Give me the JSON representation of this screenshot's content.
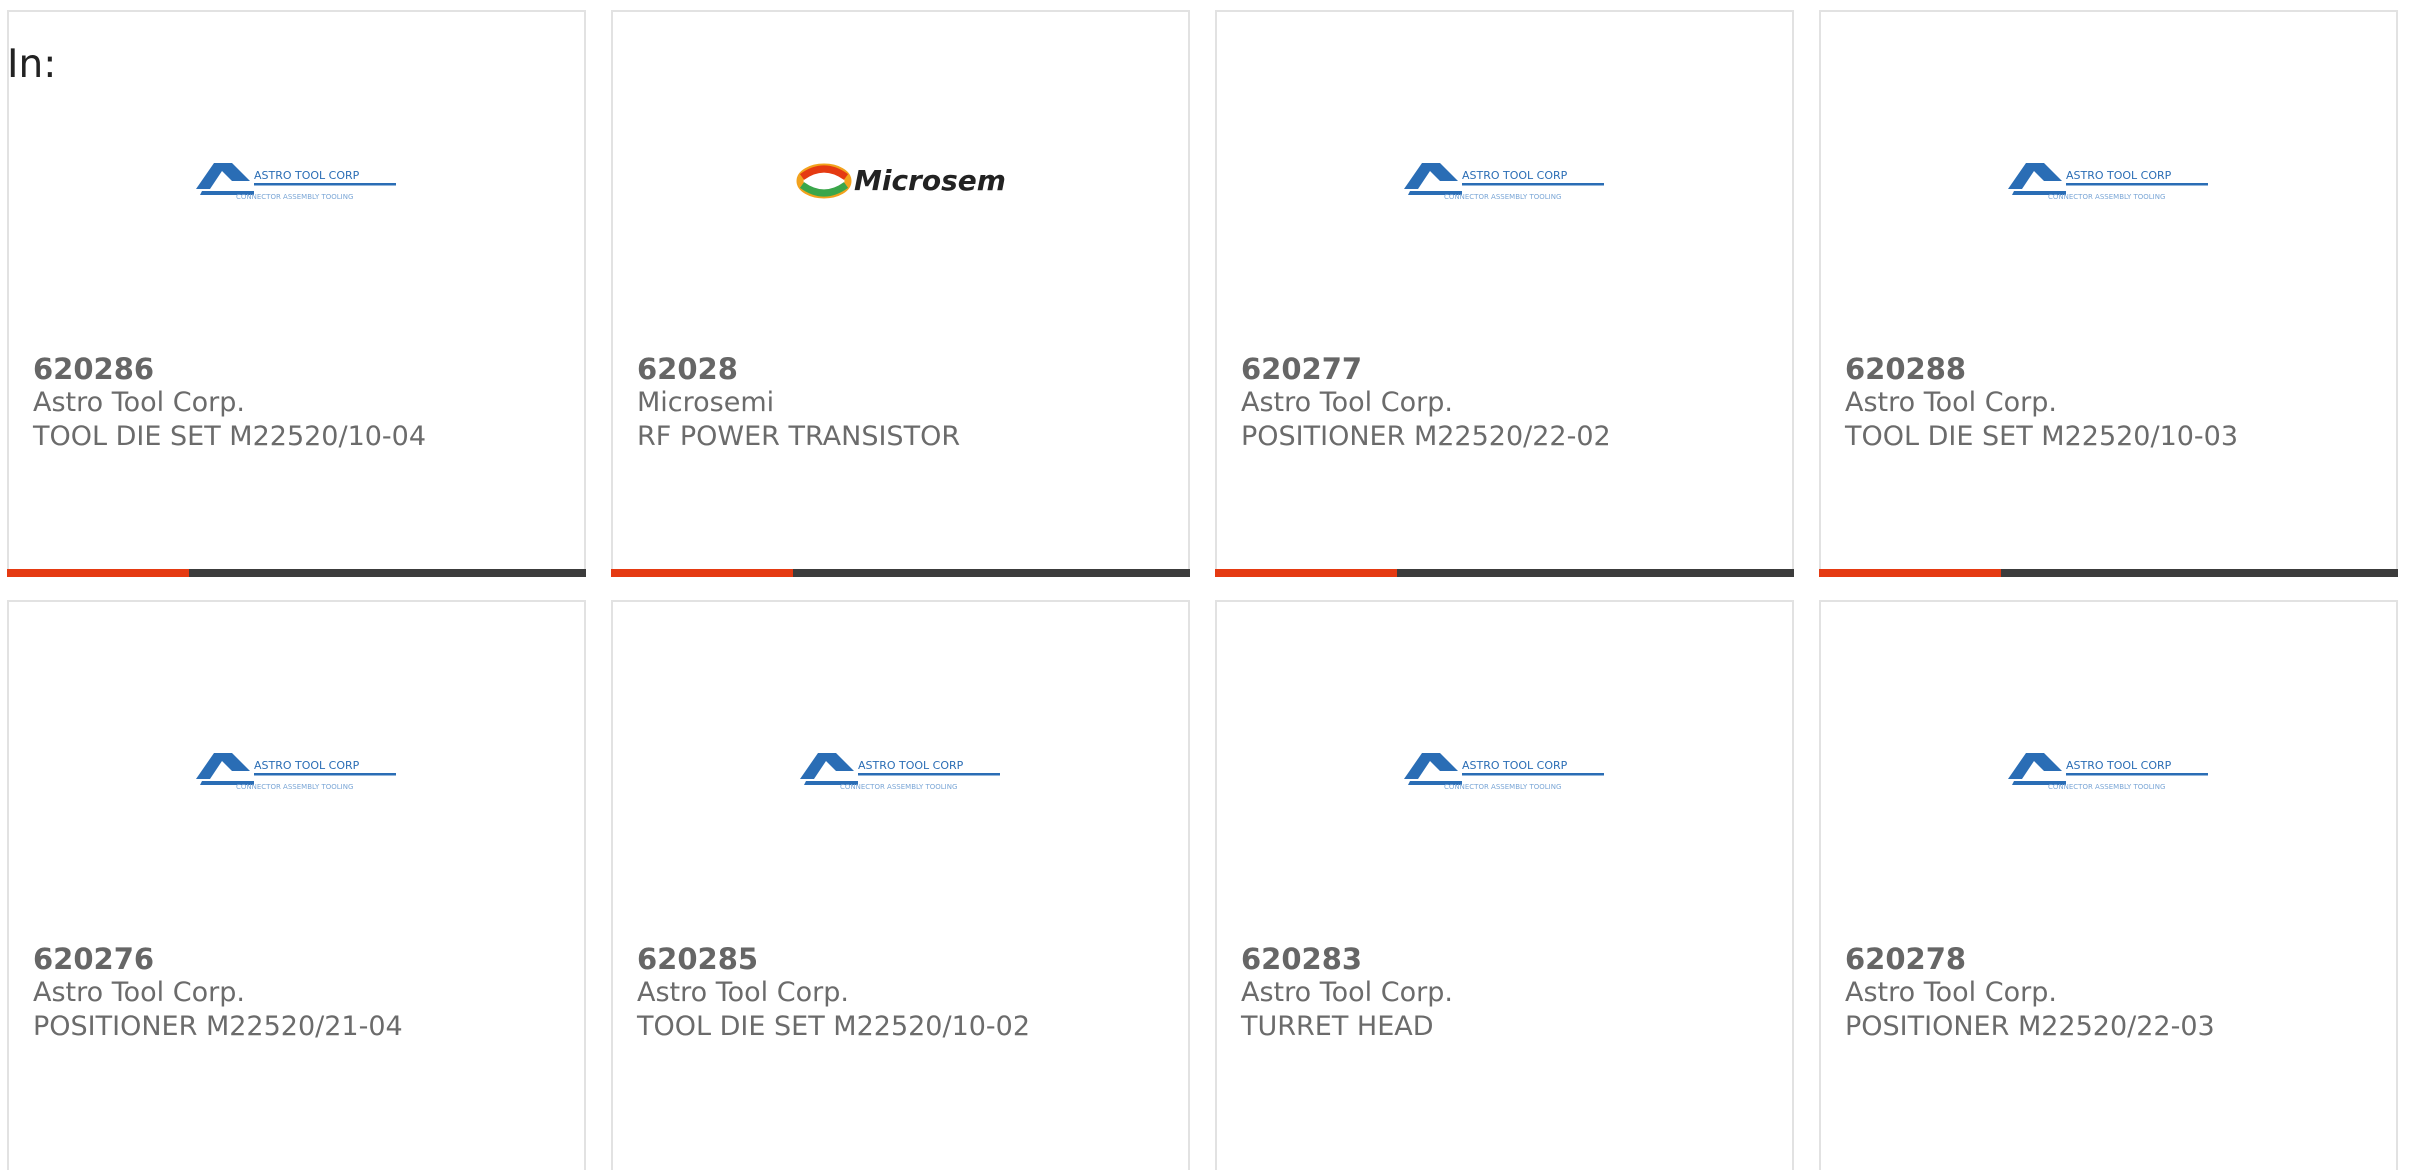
{
  "header": {
    "label": "In:"
  },
  "logos": {
    "astro": {
      "name": "ASTRO TOOL CORP",
      "tagline": "CONNECTOR ASSEMBLY TOOLING",
      "color": "#2a6db5"
    },
    "microsemi": {
      "name": "Microsemi",
      "color": "#222222"
    }
  },
  "accent_color": "#e53a12",
  "bar_color": "#3c3c3c",
  "progress_fraction": 0.315,
  "products": [
    {
      "part": "620286",
      "manufacturer": "Astro Tool Corp.",
      "description": "TOOL DIE SET M22520/10-04",
      "logo": "astro"
    },
    {
      "part": "62028",
      "manufacturer": "Microsemi",
      "description": "RF POWER TRANSISTOR",
      "logo": "microsemi"
    },
    {
      "part": "620277",
      "manufacturer": "Astro Tool Corp.",
      "description": "POSITIONER M22520/22-02",
      "logo": "astro"
    },
    {
      "part": "620288",
      "manufacturer": "Astro Tool Corp.",
      "description": "TOOL DIE SET M22520/10-03",
      "logo": "astro"
    },
    {
      "part": "620276",
      "manufacturer": "Astro Tool Corp.",
      "description": "POSITIONER M22520/21-04",
      "logo": "astro"
    },
    {
      "part": "620285",
      "manufacturer": "Astro Tool Corp.",
      "description": "TOOL DIE SET M22520/10-02",
      "logo": "astro"
    },
    {
      "part": "620283",
      "manufacturer": "Astro Tool Corp.",
      "description": "TURRET HEAD",
      "logo": "astro"
    },
    {
      "part": "620278",
      "manufacturer": "Astro Tool Corp.",
      "description": "POSITIONER M22520/22-03",
      "logo": "astro"
    }
  ]
}
